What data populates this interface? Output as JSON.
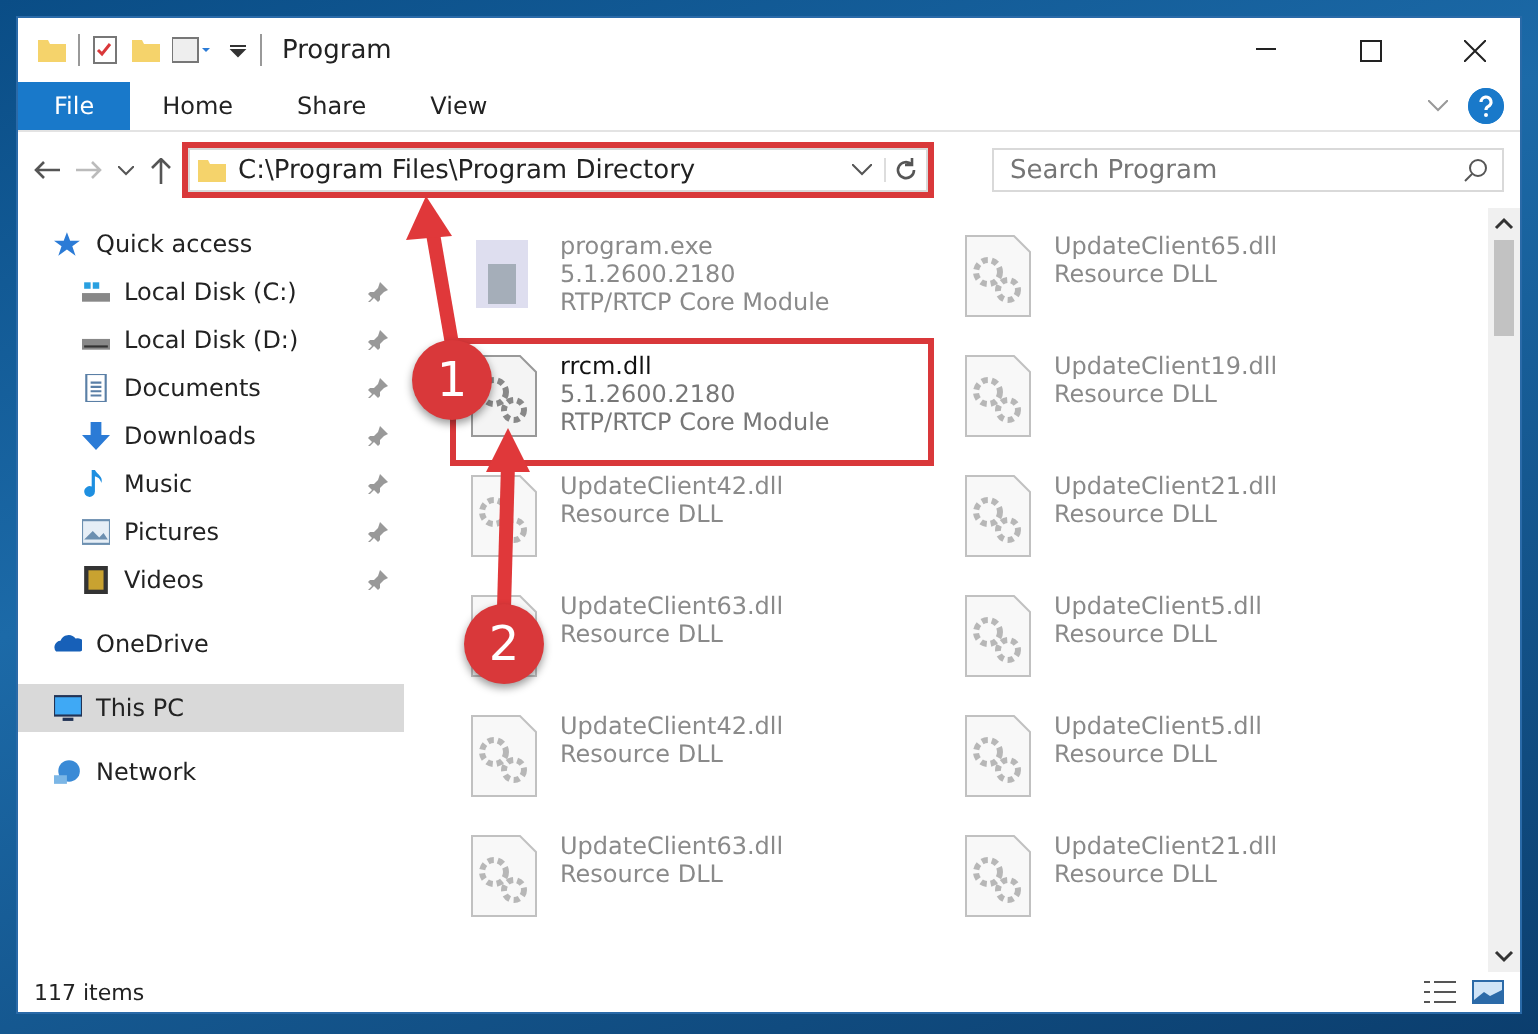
{
  "window": {
    "title": "Program"
  },
  "ribbon_tabs": [
    {
      "label": "File",
      "selected": true
    },
    {
      "label": "Home",
      "selected": false
    },
    {
      "label": "Share",
      "selected": false
    },
    {
      "label": "View",
      "selected": false
    }
  ],
  "address": {
    "value": "C:\\Program Files\\Program Directory",
    "highlighted": true
  },
  "search": {
    "placeholder": "Search Program"
  },
  "sidebar": {
    "items": [
      {
        "label": "Quick access",
        "selected": false,
        "children": [
          {
            "label": "Local Disk (C:)",
            "pinned": true,
            "selected": false
          },
          {
            "label": "Local Disk (D:)",
            "pinned": true,
            "selected": false
          },
          {
            "label": "Documents",
            "pinned": true,
            "selected": false
          },
          {
            "label": "Downloads",
            "pinned": true,
            "selected": false
          },
          {
            "label": "Music",
            "pinned": true,
            "selected": false
          },
          {
            "label": "Pictures",
            "pinned": true,
            "selected": false
          },
          {
            "label": "Videos",
            "pinned": true,
            "selected": false
          }
        ]
      },
      {
        "label": "OneDrive",
        "selected": false
      },
      {
        "label": "This PC",
        "selected": true
      },
      {
        "label": "Network",
        "selected": false
      }
    ]
  },
  "files": [
    {
      "kind": "exe",
      "name": "program.exe",
      "lines": [
        "5.1.2600.2180",
        "RTP/RTCP Core Module"
      ],
      "blurred": true,
      "highlighted": false
    },
    {
      "kind": "dll",
      "name": "UpdateClient65.dll",
      "lines": [
        "Resource DLL"
      ],
      "blurred": true,
      "highlighted": false
    },
    {
      "kind": "dll",
      "name": "rrcm.dll",
      "lines": [
        "5.1.2600.2180",
        "RTP/RTCP Core Module"
      ],
      "blurred": false,
      "highlighted": true
    },
    {
      "kind": "dll",
      "name": "UpdateClient19.dll",
      "lines": [
        "Resource DLL"
      ],
      "blurred": true,
      "highlighted": false
    },
    {
      "kind": "dll",
      "name": "UpdateClient42.dll",
      "lines": [
        "Resource DLL"
      ],
      "blurred": true,
      "highlighted": false
    },
    {
      "kind": "dll",
      "name": "UpdateClient21.dll",
      "lines": [
        "Resource DLL"
      ],
      "blurred": true,
      "highlighted": false
    },
    {
      "kind": "dll",
      "name": "UpdateClient63.dll",
      "lines": [
        "Resource DLL"
      ],
      "blurred": true,
      "highlighted": false
    },
    {
      "kind": "dll",
      "name": "UpdateClient5.dll",
      "lines": [
        "Resource DLL"
      ],
      "blurred": true,
      "highlighted": false
    },
    {
      "kind": "dll",
      "name": "UpdateClient42.dll",
      "lines": [
        "Resource DLL"
      ],
      "blurred": true,
      "highlighted": false
    },
    {
      "kind": "dll",
      "name": "UpdateClient5.dll",
      "lines": [
        "Resource DLL"
      ],
      "blurred": true,
      "highlighted": false
    },
    {
      "kind": "dll",
      "name": "UpdateClient63.dll",
      "lines": [
        "Resource DLL"
      ],
      "blurred": true,
      "highlighted": false
    },
    {
      "kind": "dll",
      "name": "UpdateClient21.dll",
      "lines": [
        "Resource DLL"
      ],
      "blurred": true,
      "highlighted": false
    }
  ],
  "status_bar": {
    "count": "117 items"
  },
  "annotations": [
    {
      "label": "1"
    },
    {
      "label": "2"
    }
  ]
}
